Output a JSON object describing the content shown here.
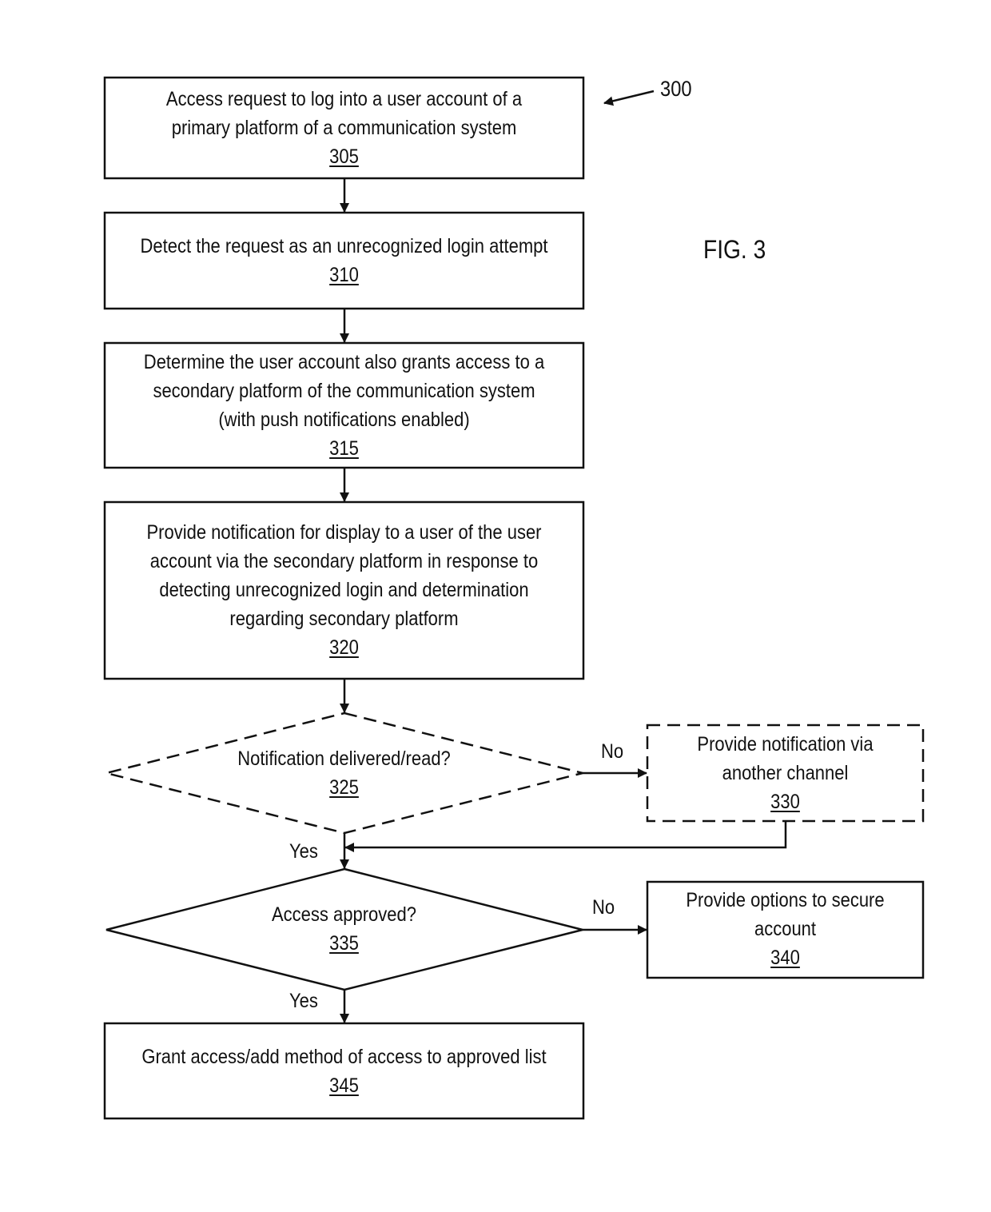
{
  "figure": {
    "title": "FIG. 3",
    "reference": "300"
  },
  "nodes": [
    {
      "id": "305",
      "type": "process",
      "style": "solid",
      "lines": [
        "Access request to log into a user account of a",
        "primary platform of a communication system"
      ],
      "ref": "305"
    },
    {
      "id": "310",
      "type": "process",
      "style": "solid",
      "lines": [
        "Detect the request as an unrecognized login attempt"
      ],
      "ref": "310"
    },
    {
      "id": "315",
      "type": "process",
      "style": "solid",
      "lines": [
        "Determine the user account also grants access to a",
        "secondary platform of the communication system",
        "(with push notifications enabled)"
      ],
      "ref": "315"
    },
    {
      "id": "320",
      "type": "process",
      "style": "solid",
      "lines": [
        "Provide notification for display to a user of the user",
        "account via the secondary platform in response to",
        "detecting unrecognized login and determination",
        "regarding secondary platform"
      ],
      "ref": "320"
    },
    {
      "id": "325",
      "type": "decision",
      "style": "dashed",
      "lines": [
        "Notification delivered/read?"
      ],
      "ref": "325"
    },
    {
      "id": "330",
      "type": "process",
      "style": "dashed",
      "lines": [
        "Provide notification via",
        "another channel"
      ],
      "ref": "330"
    },
    {
      "id": "335",
      "type": "decision",
      "style": "solid",
      "lines": [
        "Access approved?"
      ],
      "ref": "335"
    },
    {
      "id": "340",
      "type": "process",
      "style": "solid",
      "lines": [
        "Provide options to secure",
        "account"
      ],
      "ref": "340"
    },
    {
      "id": "345",
      "type": "process",
      "style": "solid",
      "lines": [
        "Grant access/add method of access to approved list"
      ],
      "ref": "345"
    }
  ],
  "edges": [
    {
      "from": "305",
      "to": "310",
      "label": ""
    },
    {
      "from": "310",
      "to": "315",
      "label": ""
    },
    {
      "from": "315",
      "to": "320",
      "label": ""
    },
    {
      "from": "320",
      "to": "325",
      "label": ""
    },
    {
      "from": "325",
      "to": "330",
      "label": "No"
    },
    {
      "from": "325",
      "to": "335",
      "label": "Yes"
    },
    {
      "from": "330",
      "to": "335",
      "label": ""
    },
    {
      "from": "335",
      "to": "340",
      "label": "No"
    },
    {
      "from": "335",
      "to": "345",
      "label": "Yes"
    }
  ],
  "edge_labels": {
    "no_325": "No",
    "yes_325": "Yes",
    "no_335": "No",
    "yes_335": "Yes"
  }
}
